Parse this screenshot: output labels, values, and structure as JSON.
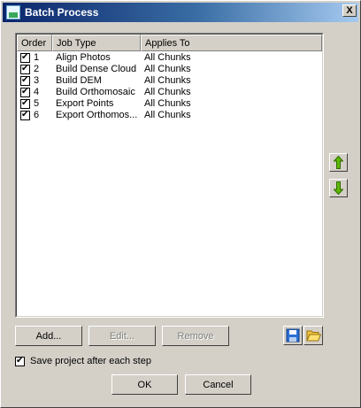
{
  "window": {
    "title": "Batch Process",
    "close_glyph": "X"
  },
  "table": {
    "headers": {
      "order": "Order",
      "job_type": "Job Type",
      "applies_to": "Applies To"
    },
    "rows": [
      {
        "checked": true,
        "order": "1",
        "job_type": "Align Photos",
        "applies_to": "All Chunks"
      },
      {
        "checked": true,
        "order": "2",
        "job_type": "Build Dense Cloud",
        "applies_to": "All Chunks"
      },
      {
        "checked": true,
        "order": "3",
        "job_type": "Build DEM",
        "applies_to": "All Chunks"
      },
      {
        "checked": true,
        "order": "4",
        "job_type": "Build Orthomosaic",
        "applies_to": "All Chunks"
      },
      {
        "checked": true,
        "order": "5",
        "job_type": "Export Points",
        "applies_to": "All Chunks"
      },
      {
        "checked": true,
        "order": "6",
        "job_type": "Export Orthomos...",
        "applies_to": "All Chunks"
      }
    ]
  },
  "buttons": {
    "add": "Add...",
    "edit": "Edit...",
    "remove": "Remove",
    "ok": "OK",
    "cancel": "Cancel"
  },
  "options": {
    "save_project_label": "Save project after each step",
    "save_project_checked": true
  },
  "icons": {
    "move_up": "arrow-up-icon",
    "move_down": "arrow-down-icon",
    "save": "floppy-disk-icon",
    "open": "folder-open-icon"
  },
  "colors": {
    "arrow": "#5fb800",
    "title_bar": "#0a246a"
  }
}
